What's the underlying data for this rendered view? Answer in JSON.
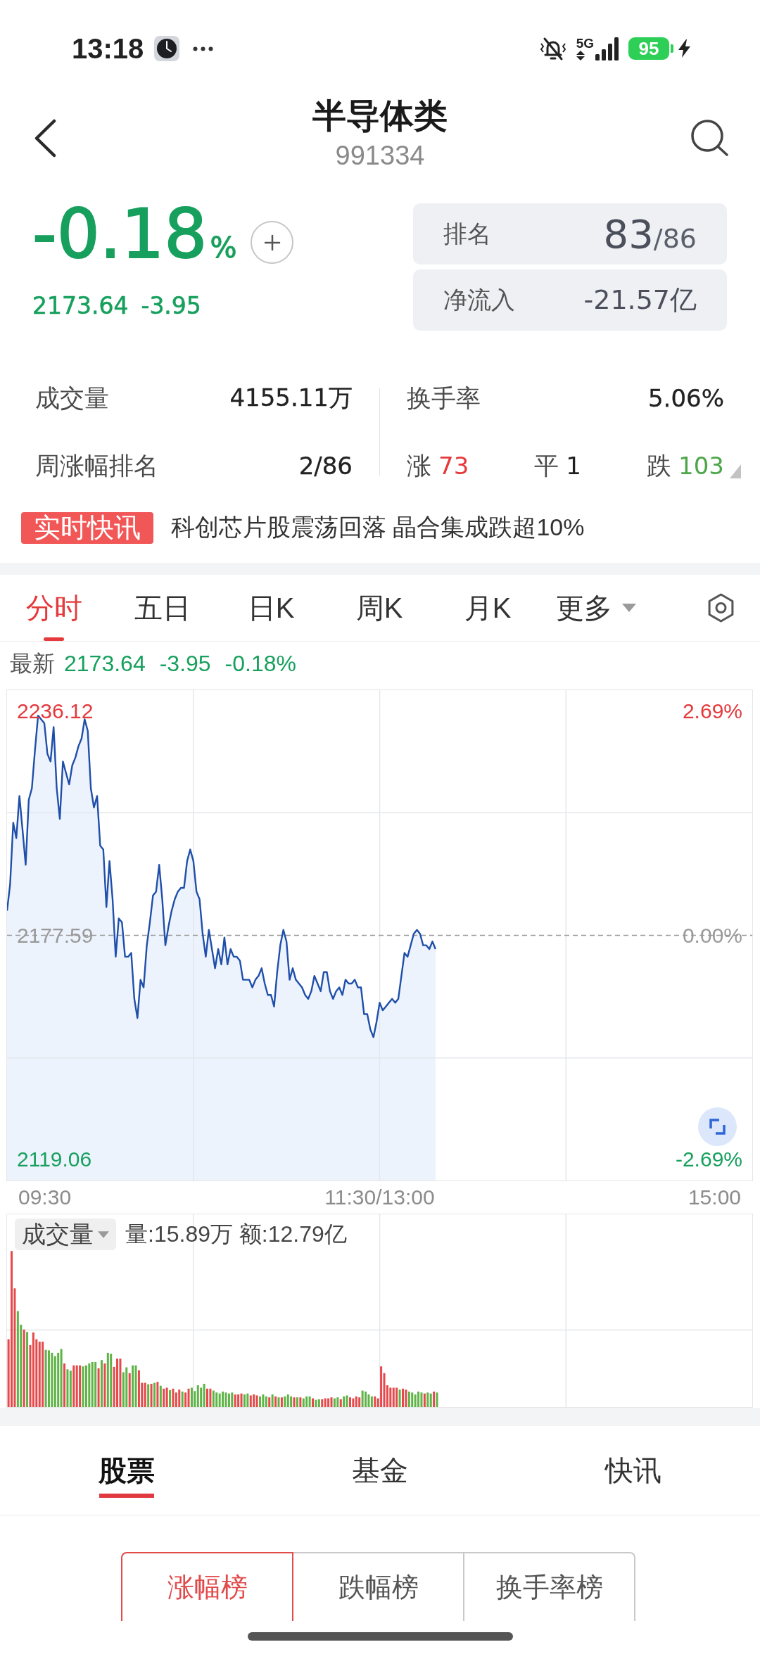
{
  "status_bar": {
    "time": "13:18",
    "network": "5G",
    "battery": "95"
  },
  "header": {
    "title": "半导体类",
    "code": "991334"
  },
  "quote": {
    "falling": true,
    "change_percent": "-0.18",
    "unit": "%",
    "price": "2173.64",
    "change": "-3.95"
  },
  "rank_cards": [
    {
      "label": "排名",
      "value": "83",
      "total": "/86"
    },
    {
      "label": "净流入",
      "value": "-21.57亿"
    }
  ],
  "stats": {
    "left": [
      {
        "label": "成交量",
        "value": "4155.11万"
      },
      {
        "label": "周涨幅排名",
        "value": "2/86"
      }
    ],
    "right": [
      {
        "label": "换手率",
        "value": "5.06%"
      }
    ],
    "breadth": [
      {
        "label": "涨",
        "count": "73",
        "color": "#e5393c"
      },
      {
        "label": "平",
        "count": "1",
        "color": "#1f1f1f"
      },
      {
        "label": "跌",
        "count": "103",
        "color": "#4ea64a"
      }
    ]
  },
  "news": {
    "badge": "实时快讯",
    "headline": "科创芯片股震荡回落 晶合集成跌超10%"
  },
  "chart_tabs": [
    {
      "label": "分时",
      "selected": true,
      "kind": "tab"
    },
    {
      "label": "五日",
      "selected": false,
      "kind": "tab"
    },
    {
      "label": "日K",
      "selected": false,
      "kind": "tab"
    },
    {
      "label": "周K",
      "selected": false,
      "kind": "tab"
    },
    {
      "label": "月K",
      "selected": false,
      "kind": "tab"
    },
    {
      "label": "更多",
      "selected": false,
      "kind": "menu"
    }
  ],
  "latest": {
    "label": "最新",
    "falling": true,
    "price": "2173.64",
    "change": "-3.95",
    "change_percent": "-0.18%"
  },
  "price_chart": {
    "percent_labels": [
      {
        "text": "2.69%",
        "color": "#e5393c"
      },
      {
        "text": "0.00%",
        "color": "#999999"
      },
      {
        "text": "-2.69%",
        "color": "#17a05d"
      }
    ],
    "chart_data": {
      "type": "area",
      "ylim": [
        2113.55,
        2241.63
      ],
      "yticks": [
        {
          "value": 2119.06,
          "label": "2119.06"
        },
        {
          "value": 2236.12,
          "label": "2236.12"
        }
      ],
      "ref_lines": [
        {
          "axis": "y",
          "value": 2177.59,
          "label": "2177.59"
        }
      ],
      "categories": [
        null,
        null,
        null,
        null,
        null,
        null,
        null,
        null,
        null,
        null,
        null,
        null,
        null,
        null,
        null,
        null,
        null,
        null,
        null,
        null,
        null,
        null,
        null,
        null,
        null,
        null,
        null,
        null,
        null,
        null,
        null,
        null,
        null,
        null,
        null,
        null,
        null,
        null,
        null,
        null,
        null,
        null,
        null,
        null,
        null,
        null,
        null,
        null,
        null,
        null,
        null,
        null,
        null,
        null,
        null,
        null,
        null,
        null,
        null,
        null,
        null,
        null,
        null,
        null,
        null,
        null,
        null,
        null,
        null,
        null,
        null,
        null,
        null,
        null,
        null,
        null,
        null,
        null,
        null,
        null,
        null,
        null,
        null,
        null,
        null,
        null,
        null,
        null,
        null,
        null,
        null,
        null,
        null,
        null,
        null,
        null,
        null,
        null,
        null,
        null,
        null,
        null,
        null,
        null,
        null,
        null,
        null,
        null,
        null,
        null,
        null,
        null,
        null,
        null,
        null,
        null,
        null,
        null,
        null,
        null,
        null,
        null,
        null,
        null,
        null,
        null,
        null,
        null,
        null,
        null,
        null,
        null,
        null,
        null,
        null,
        null,
        null,
        null,
        null,
        null,
        null,
        null,
        null,
        null,
        null,
        null,
        null,
        null,
        null,
        null,
        null,
        null,
        null,
        null,
        null,
        null,
        null,
        null,
        null,
        null,
        null,
        null,
        null,
        null,
        null,
        null,
        null,
        null,
        null,
        null,
        null,
        null,
        null,
        null,
        null,
        null,
        null,
        null,
        null,
        null,
        null,
        null,
        null,
        null,
        null,
        null,
        null,
        null,
        null,
        null,
        null,
        null,
        null,
        null,
        null,
        null,
        null,
        null,
        null,
        null,
        null,
        null,
        null,
        null,
        null,
        null,
        null,
        null,
        null,
        null,
        null,
        null,
        null,
        null,
        null,
        null,
        null,
        null,
        null,
        null,
        null,
        null,
        null,
        null,
        null,
        null,
        null,
        null,
        null,
        null,
        null,
        null,
        null,
        null,
        null,
        null,
        null,
        null,
        null,
        null,
        null
      ],
      "values": [
        2184,
        2191,
        2207,
        2203,
        2214,
        2205,
        2196,
        2213,
        2216,
        2226,
        2235,
        2234,
        2233,
        2225,
        2223,
        2232,
        2216,
        2208,
        2223,
        2220,
        2217,
        2222,
        2224,
        2227,
        2229,
        2234,
        2231,
        2216,
        2211,
        2214,
        2201,
        2200,
        2185,
        2197,
        2187,
        2172,
        2182,
        2181,
        2172,
        2172,
        2173,
        2161,
        2156,
        2166,
        2164,
        2175,
        2181,
        2188,
        2189,
        2196,
        2187,
        2175,
        2180,
        2184,
        2187,
        2189,
        2190,
        2190,
        2197,
        2200,
        2197,
        2189,
        2187,
        2178,
        2172,
        2179,
        2174,
        2169,
        2174,
        2170,
        2177,
        2170,
        2174,
        2172,
        2172,
        2171,
        2166,
        2166,
        2166,
        2164,
        2166,
        2167,
        2169,
        2165,
        2162,
        2162,
        2159,
        2168,
        2175,
        2179,
        2176,
        2166,
        2169,
        2166,
        2165,
        2164,
        2162,
        2161,
        2163,
        2167,
        2165,
        2163,
        2168,
        2168,
        2163,
        2161,
        2163,
        2164,
        2162,
        2166,
        2165,
        2165,
        2166,
        2164,
        2164,
        2157,
        2157,
        2153,
        2151,
        2155,
        2160,
        2158,
        2159,
        2160,
        2161,
        2160,
        2161,
        2167,
        2173,
        2172,
        2175,
        2178,
        2179,
        2178,
        2175,
        2175,
        2174,
        2176,
        2174,
        null,
        null,
        null,
        null,
        null,
        null,
        null,
        null,
        null,
        null,
        null,
        null,
        null,
        null,
        null,
        null,
        null,
        null,
        null,
        null,
        null,
        null,
        null,
        null,
        null,
        null,
        null,
        null,
        null,
        null,
        null,
        null,
        null,
        null,
        null,
        null,
        null,
        null,
        null,
        null,
        null,
        null,
        null,
        null,
        null,
        null,
        null,
        null,
        null,
        null,
        null,
        null,
        null,
        null,
        null,
        null,
        null,
        null,
        null,
        null,
        null,
        null,
        null,
        null,
        null,
        null,
        null,
        null,
        null,
        null,
        null,
        null,
        null,
        null,
        null,
        null,
        null,
        null,
        null,
        null,
        null,
        null,
        null,
        null,
        null,
        null,
        null,
        null,
        null,
        null,
        null,
        null,
        null,
        null,
        null,
        null,
        null,
        null,
        null,
        null,
        null,
        null
      ]
    },
    "time_labels": [
      "09:30",
      "11:30/13:00",
      "15:00"
    ]
  },
  "volume_chart": {
    "indicator": "成交量",
    "summary": "量:15.89万 额:12.79亿"
  },
  "list_tabs": [
    {
      "label": "股票",
      "selected": true
    },
    {
      "label": "基金",
      "selected": false
    },
    {
      "label": "快讯",
      "selected": false
    }
  ],
  "rankings": [
    {
      "label": "涨幅榜",
      "selected": true
    },
    {
      "label": "跌幅榜",
      "selected": false
    },
    {
      "label": "换手率榜",
      "selected": false
    }
  ]
}
